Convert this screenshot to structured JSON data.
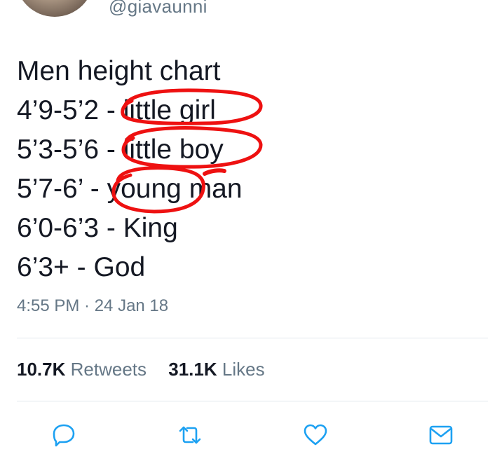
{
  "header": {
    "handle": "@giavaunni",
    "avatar_icon": "profile-photo"
  },
  "tweet": {
    "lines": [
      "Men height chart",
      "4’9-5’2 - little girl",
      "5’3-5’6 - little boy",
      "5’7-6’ - young man",
      "6’0-6’3 - King",
      "6’3+ - God"
    ],
    "timestamp": "4:55 PM · 24 Jan 18",
    "annotation_color": "#ee1111"
  },
  "stats": {
    "retweets_count": "10.7K",
    "retweets_label": "Retweets",
    "likes_count": "31.1K",
    "likes_label": "Likes"
  },
  "actions": [
    {
      "name": "reply",
      "icon": "speech-bubble-icon"
    },
    {
      "name": "retweet",
      "icon": "retweet-arrows-icon"
    },
    {
      "name": "like",
      "icon": "heart-icon"
    },
    {
      "name": "share",
      "icon": "envelope-icon"
    }
  ],
  "colors": {
    "text": "#141823",
    "muted": "#657786",
    "icon": "#1da1f2",
    "divider": "#e1e8ed"
  }
}
